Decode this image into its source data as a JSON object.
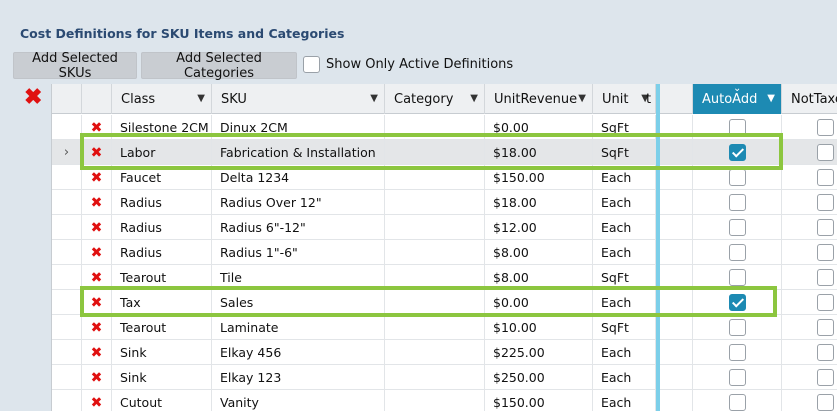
{
  "title": "Cost Definitions for SKU Items and Categories",
  "toolbar": {
    "add_skus": "Add Selected SKUs",
    "add_categories": "Add Selected Categories",
    "show_active": "Show Only Active Definitions",
    "show_active_checked": false
  },
  "columns": {
    "class": "Class",
    "sku": "SKU",
    "category": "Category",
    "unit_revenue": "UnitRevenue",
    "unit": "Unit",
    "truncated": "t",
    "auto_add": "AutoAdd",
    "not_taxed": "NotTaxed"
  },
  "rows": [
    {
      "class": "Silestone 2CM",
      "sku": "Dinux 2CM",
      "category": "",
      "revenue": "$0.00",
      "unit": "SqFt",
      "auto_add": false,
      "not_taxed": false
    },
    {
      "class": "Labor",
      "sku": "Fabrication & Installation",
      "category": "",
      "revenue": "$18.00",
      "unit": "SqFt",
      "auto_add": true,
      "not_taxed": false
    },
    {
      "class": "Faucet",
      "sku": "Delta 1234",
      "category": "",
      "revenue": "$150.00",
      "unit": "Each",
      "auto_add": false,
      "not_taxed": false
    },
    {
      "class": "Radius",
      "sku": "Radius Over 12\"",
      "category": "",
      "revenue": "$18.00",
      "unit": "Each",
      "auto_add": false,
      "not_taxed": false
    },
    {
      "class": "Radius",
      "sku": "Radius 6\"-12\"",
      "category": "",
      "revenue": "$12.00",
      "unit": "Each",
      "auto_add": false,
      "not_taxed": false
    },
    {
      "class": "Radius",
      "sku": "Radius 1\"-6\"",
      "category": "",
      "revenue": "$8.00",
      "unit": "Each",
      "auto_add": false,
      "not_taxed": false
    },
    {
      "class": "Tearout",
      "sku": "Tile",
      "category": "",
      "revenue": "$8.00",
      "unit": "SqFt",
      "auto_add": false,
      "not_taxed": false
    },
    {
      "class": "Tax",
      "sku": "Sales",
      "category": "",
      "revenue": "$0.00",
      "unit": "Each",
      "auto_add": true,
      "not_taxed": false
    },
    {
      "class": "Tearout",
      "sku": "Laminate",
      "category": "",
      "revenue": "$10.00",
      "unit": "SqFt",
      "auto_add": false,
      "not_taxed": false
    },
    {
      "class": "Sink",
      "sku": "Elkay 456",
      "category": "",
      "revenue": "$225.00",
      "unit": "Each",
      "auto_add": false,
      "not_taxed": false
    },
    {
      "class": "Sink",
      "sku": "Elkay 123",
      "category": "",
      "revenue": "$250.00",
      "unit": "Each",
      "auto_add": false,
      "not_taxed": false
    },
    {
      "class": "Cutout",
      "sku": "Vanity",
      "category": "",
      "revenue": "$150.00",
      "unit": "Each",
      "auto_add": false,
      "not_taxed": false
    }
  ],
  "selected_row": 1,
  "colors": {
    "accent": "#1d8ab3",
    "delete": "#e01010",
    "highlight": "#8cc63f"
  }
}
